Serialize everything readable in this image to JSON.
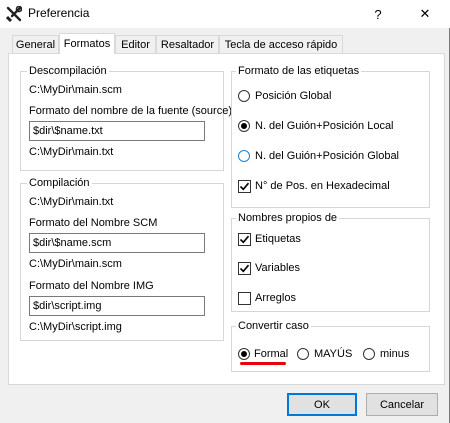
{
  "window": {
    "title": "Preferencia",
    "help_label": "?",
    "close_label": "✕"
  },
  "tabs": [
    {
      "label": "General"
    },
    {
      "label": "Formatos"
    },
    {
      "label": "Editor"
    },
    {
      "label": "Resaltador"
    },
    {
      "label": "Tecla de acceso rápido"
    }
  ],
  "decompilation": {
    "title": "Descompilación",
    "path": "C:\\MyDir\\main.scm",
    "source_format_label": "Formato del nombre de la fuente (source)",
    "source_format_value": "$dir\\$name.txt",
    "source_preview": "C:\\MyDir\\main.txt"
  },
  "compilation": {
    "title": "Compilación",
    "path": "C:\\MyDir\\main.txt",
    "scm_format_label": "Formato del Nombre SCM",
    "scm_format_value": "$dir\\$name.scm",
    "scm_preview": "C:\\MyDir\\main.scm",
    "img_format_label": "Formato del Nombre IMG",
    "img_format_value": "$dir\\script.img",
    "img_preview": "C:\\MyDir\\script.img"
  },
  "label_format": {
    "title": "Formato de las etiquetas",
    "options": [
      {
        "label": "Posición Global",
        "selected": false
      },
      {
        "label": "N. del Guión+Posición Local",
        "selected": true
      },
      {
        "label": "N. del Guión+Posición Global",
        "selected": false
      }
    ],
    "hex_label": "N° de Pos. en Hexadecimal",
    "hex_checked": true
  },
  "proper_names": {
    "title": "Nombres propios de",
    "items": [
      {
        "label": "Etiquetas",
        "checked": true
      },
      {
        "label": "Variables",
        "checked": true
      },
      {
        "label": "Arreglos",
        "checked": false
      }
    ]
  },
  "case_convert": {
    "title": "Convertir caso",
    "options": [
      {
        "label": "Formal",
        "selected": true
      },
      {
        "label": "MAYÚS",
        "selected": false
      },
      {
        "label": "minus",
        "selected": false
      }
    ]
  },
  "buttons": {
    "ok": "OK",
    "cancel": "Cancelar"
  },
  "colors": {
    "annotation_underline": "#e8000b",
    "focus_blue": "#0078d7"
  }
}
